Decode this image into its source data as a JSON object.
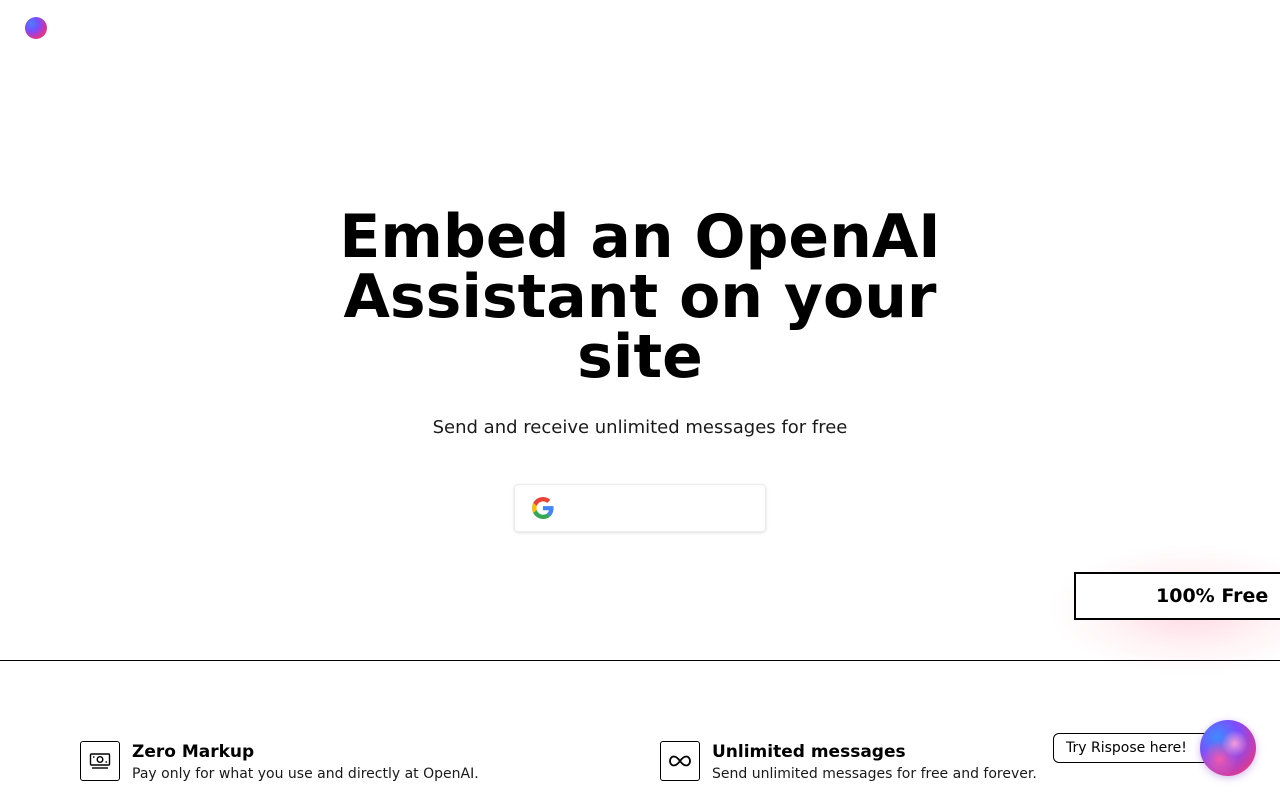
{
  "brand": {
    "logo_icon": "rispose-logo-icon"
  },
  "hero": {
    "title": "Embed an OpenAI Assistant on your site",
    "subtitle": "Send and receive unlimited messages for free",
    "google_button_icon": "google-icon"
  },
  "badge": {
    "label": "100% Free"
  },
  "features": [
    {
      "icon": "money-icon",
      "title": "Zero Markup",
      "description": "Pay only for what you use and directly at OpenAI."
    },
    {
      "icon": "infinity-icon",
      "title": "Unlimited messages",
      "description": "Send unlimited messages for free and forever."
    }
  ],
  "chat_widget": {
    "prompt": "Try Rispose here!",
    "icon": "chat-orb-icon"
  }
}
